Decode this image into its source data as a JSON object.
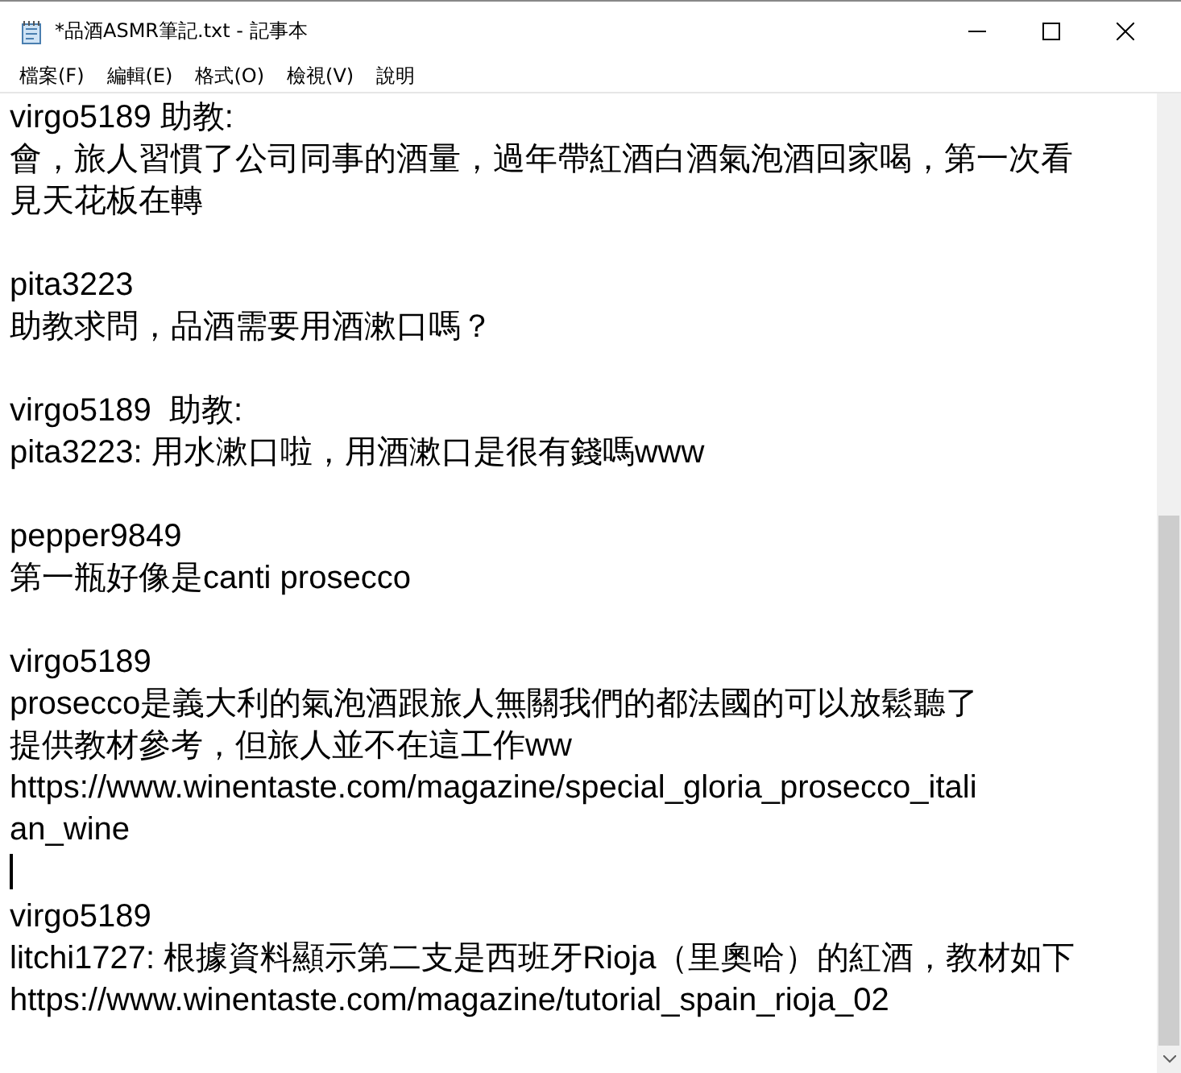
{
  "window": {
    "title": "*品酒ASMR筆記.txt - 記事本"
  },
  "menu": [
    "檔案(F)",
    "編輯(E)",
    "格式(O)",
    "檢視(V)",
    "說明"
  ],
  "editor": {
    "lines": [
      {
        "kind": "text",
        "text": "virgo5189 助教:"
      },
      {
        "kind": "text",
        "text": "會，旅人習慣了公司同事的酒量，過年帶紅酒白酒氣泡酒回家喝，第一次看"
      },
      {
        "kind": "text",
        "text": "見天花板在轉"
      },
      {
        "kind": "blank"
      },
      {
        "kind": "text",
        "text": "pita3223"
      },
      {
        "kind": "text",
        "text": "助教求問，品酒需要用酒漱口嗎？"
      },
      {
        "kind": "blank"
      },
      {
        "kind": "text",
        "text": "virgo5189  助教:"
      },
      {
        "kind": "text",
        "text": "pita3223: 用水漱口啦，用酒漱口是很有錢嗎www"
      },
      {
        "kind": "blank"
      },
      {
        "kind": "text",
        "text": "pepper9849"
      },
      {
        "kind": "text",
        "text": "第一瓶好像是canti prosecco"
      },
      {
        "kind": "blank"
      },
      {
        "kind": "text",
        "text": "virgo5189"
      },
      {
        "kind": "text",
        "text": "prosecco是義大利的氣泡酒跟旅人無關我們的都法國的可以放鬆聽了"
      },
      {
        "kind": "text",
        "text": "提供教材參考，但旅人並不在這工作ww"
      },
      {
        "kind": "text",
        "text": "https://www.winentaste.com/magazine/special_gloria_prosecco_itali"
      },
      {
        "kind": "text",
        "text": "an_wine"
      },
      {
        "kind": "caret"
      },
      {
        "kind": "text",
        "text": "virgo5189"
      },
      {
        "kind": "text",
        "text": "litchi1727: 根據資料顯示第二支是西班牙Rioja（里奧哈）的紅酒，教材如下"
      },
      {
        "kind": "text",
        "text": "https://www.winentaste.com/magazine/tutorial_spain_rioja_02"
      }
    ]
  }
}
